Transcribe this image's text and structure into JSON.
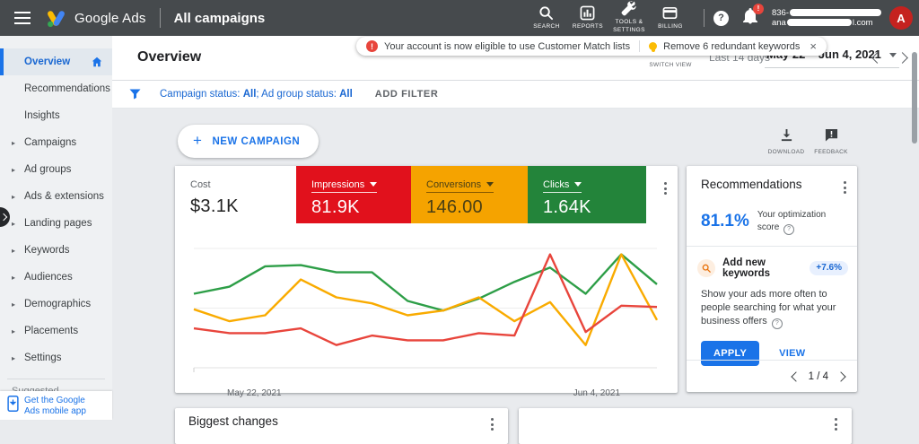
{
  "topbar": {
    "app_name": "Google Ads",
    "page_title": "All campaigns",
    "nav": [
      {
        "label": "SEARCH"
      },
      {
        "label": "REPORTS"
      },
      {
        "label": "TOOLS & SETTINGS"
      },
      {
        "label": "BILLING"
      }
    ],
    "help_glyph": "?",
    "bell_badge": "!",
    "account_id_visible": "836-",
    "account_email_start": "ana",
    "account_email_end": "l.com",
    "avatar_letter": "A"
  },
  "notifications": {
    "items": [
      {
        "icon": "error",
        "text": "Your account is now eligible to use Customer Match lists"
      },
      {
        "icon": "bulb",
        "text": "Remove 6 redundant keywords"
      }
    ],
    "close_glyph": "×"
  },
  "sidebar": {
    "items": [
      {
        "slug": "overview",
        "label": "Overview",
        "selected": true,
        "home": true
      },
      {
        "slug": "recommendations",
        "label": "Recommendations"
      },
      {
        "slug": "insights",
        "label": "Insights"
      },
      {
        "slug": "campaigns",
        "label": "Campaigns",
        "expandable": true
      },
      {
        "slug": "ad-groups",
        "label": "Ad groups",
        "expandable": true
      },
      {
        "slug": "ads-extensions",
        "label": "Ads & extensions",
        "expandable": true
      },
      {
        "slug": "landing-pages",
        "label": "Landing pages",
        "expandable": true
      },
      {
        "slug": "keywords",
        "label": "Keywords",
        "expandable": true
      },
      {
        "slug": "audiences",
        "label": "Audiences",
        "expandable": true
      },
      {
        "slug": "demographics",
        "label": "Demographics",
        "expandable": true
      },
      {
        "slug": "placements",
        "label": "Placements",
        "expandable": true
      },
      {
        "slug": "settings",
        "label": "Settings",
        "expandable": true
      }
    ],
    "suggested_label": "Suggested",
    "mobile_app_line1": "Get the Google",
    "mobile_app_line2": "Ads mobile app"
  },
  "header": {
    "title": "Overview",
    "switch_view_label": "SWITCH VIEW",
    "date_preset": "Last 14 days",
    "date_range": "May 22 – Jun 4, 2021"
  },
  "filter": {
    "seg1": "Campaign status: ",
    "seg2": "All",
    "seg3": "; Ad group status: ",
    "seg4": "All",
    "add_filter": "ADD FILTER"
  },
  "toolbar": {
    "new_campaign": "NEW CAMPAIGN",
    "plus_glyph": "+",
    "download_label": "DOWNLOAD",
    "feedback_label": "FEEDBACK"
  },
  "metrics": [
    {
      "label": "Cost",
      "value": "$3.1K",
      "bg": "#ffffff",
      "fg": "#212121",
      "dropdown": false
    },
    {
      "label": "Impressions",
      "value": "81.9K",
      "bg": "#e1111c",
      "fg": "#ffffff",
      "dropdown": true
    },
    {
      "label": "Conversions",
      "value": "146.00",
      "bg": "#f5a300",
      "fg": "#4a3f14",
      "dropdown": true
    },
    {
      "label": "Clicks",
      "value": "1.64K",
      "bg": "#23843a",
      "fg": "#ffffff",
      "dropdown": true
    }
  ],
  "chart_data": {
    "type": "line",
    "title": "",
    "xlabel": "",
    "ylabel": "",
    "x_axis_labels": [
      "May 22, 2021",
      "Jun 4, 2021"
    ],
    "x_range": [
      "May 22, 2021",
      "Jun 4, 2021"
    ],
    "num_points": 14,
    "grid": "two horizontal gridlines (mid and top), values normalized 0-100 of plot height",
    "ylim": [
      0,
      105
    ],
    "legend_position": "none (colors match metric blocks above)",
    "series": [
      {
        "name": "Impressions",
        "color": "#e8453c",
        "values": [
          33,
          29,
          29,
          33,
          19,
          27,
          23,
          23,
          29,
          27,
          95,
          30,
          52,
          51
        ]
      },
      {
        "name": "Conversions",
        "color": "#f9ab00",
        "values": [
          49,
          39,
          44,
          74,
          59,
          54,
          44,
          48,
          59,
          39,
          55,
          19,
          95,
          40
        ]
      },
      {
        "name": "Clicks",
        "color": "#2d9e47",
        "values": [
          62,
          68,
          85,
          86,
          80,
          80,
          56,
          48,
          58,
          72,
          84,
          62,
          95,
          70
        ]
      }
    ]
  },
  "recommendations": {
    "title": "Recommendations",
    "score_value": "81.1%",
    "score_label_line1": "Your optimization",
    "score_label_line2": "score",
    "keyword_title": "Add new keywords",
    "keyword_badge": "+7.6%",
    "body": "Show your ads more often to people searching for what your business offers",
    "apply_label": "APPLY",
    "view_label": "VIEW",
    "pagination": "1 / 4"
  },
  "bottom_cards": [
    {
      "title": "Biggest changes"
    },
    {
      "title": ""
    }
  ],
  "colors": {
    "accent_blue": "#1a73e8",
    "topbar": "#464a4d",
    "impressions_red": "#e1111c",
    "conversions_orange": "#f5a300",
    "clicks_green": "#23843a",
    "badge_red": "#e8453c",
    "bulb_yellow": "#fbbc04"
  }
}
